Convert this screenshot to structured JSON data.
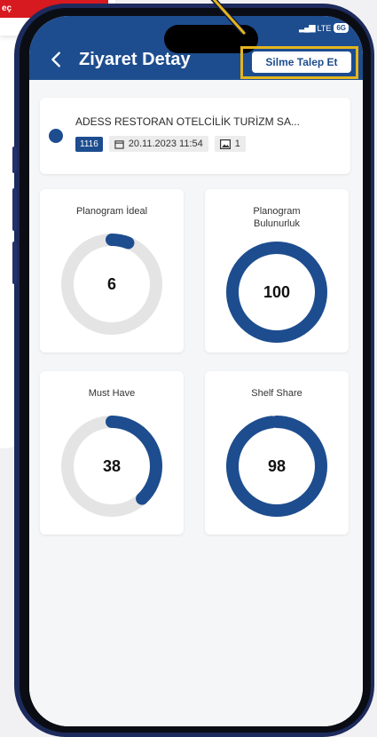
{
  "corner_label": "eç",
  "status_bar": {
    "network": "LTE",
    "generation": "6G"
  },
  "header": {
    "title": "Ziyaret Detay",
    "delete_request_label": "Silme Talep Et"
  },
  "visit": {
    "store_name": "ADESS RESTORAN OTELCİLİK TURİZM SA...",
    "id": "1116",
    "datetime": "20.11.2023 11:54",
    "photo_count": "1"
  },
  "metrics": [
    {
      "label": "Planogram İdeal",
      "value": "6",
      "percent": 6
    },
    {
      "label": "Planogram Bulunurluk",
      "value": "100",
      "percent": 100
    },
    {
      "label": "Must Have",
      "value": "38",
      "percent": 38
    },
    {
      "label": "Shelf Share",
      "value": "98",
      "percent": 98
    }
  ],
  "colors": {
    "brand_blue": "#1d4d8f",
    "track_gray": "#e4e4e4",
    "highlight_yellow": "#e5b51c",
    "red_accent": "#d71920"
  },
  "icons": {
    "back": "chevron-left-icon",
    "calendar": "calendar-icon",
    "photo": "image-icon"
  }
}
